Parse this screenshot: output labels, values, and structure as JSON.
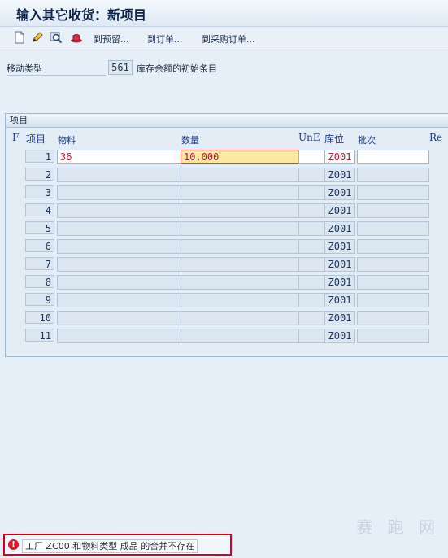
{
  "window": {
    "title": "输入其它收货：新项目"
  },
  "toolbar": {
    "icons": [
      "new-document-icon",
      "edit-pencil-icon",
      "magnifier-icon",
      "hat-icon"
    ],
    "buttons": [
      "到预留...",
      "到订单...",
      "到采购订单..."
    ]
  },
  "header": {
    "movement_type_label": "移动类型",
    "movement_type_value": "561",
    "movement_type_desc": "库存余额的初始条目"
  },
  "items_panel": {
    "title": "项目",
    "columns": {
      "f": "F",
      "item": "项目",
      "material": "物料",
      "quantity": "数量",
      "une": "UnE",
      "storage": "库位",
      "batch": "批次",
      "re": "Re"
    },
    "rows": [
      {
        "item": "1",
        "material": "36",
        "quantity": "10,000",
        "une": "",
        "storage": "Z001",
        "batch": ""
      },
      {
        "item": "2",
        "material": "",
        "quantity": "",
        "une": "",
        "storage": "Z001",
        "batch": ""
      },
      {
        "item": "3",
        "material": "",
        "quantity": "",
        "une": "",
        "storage": "Z001",
        "batch": ""
      },
      {
        "item": "4",
        "material": "",
        "quantity": "",
        "une": "",
        "storage": "Z001",
        "batch": ""
      },
      {
        "item": "5",
        "material": "",
        "quantity": "",
        "une": "",
        "storage": "Z001",
        "batch": ""
      },
      {
        "item": "6",
        "material": "",
        "quantity": "",
        "une": "",
        "storage": "Z001",
        "batch": ""
      },
      {
        "item": "7",
        "material": "",
        "quantity": "",
        "une": "",
        "storage": "Z001",
        "batch": ""
      },
      {
        "item": "8",
        "material": "",
        "quantity": "",
        "une": "",
        "storage": "Z001",
        "batch": ""
      },
      {
        "item": "9",
        "material": "",
        "quantity": "",
        "une": "",
        "storage": "Z001",
        "batch": ""
      },
      {
        "item": "10",
        "material": "",
        "quantity": "",
        "une": "",
        "storage": "Z001",
        "batch": ""
      },
      {
        "item": "11",
        "material": "",
        "quantity": "",
        "une": "",
        "storage": "Z001",
        "batch": ""
      }
    ]
  },
  "status_bar": {
    "type": "error",
    "icon": "error-icon",
    "message": "工厂 ZC00 和物料类型 成品 的合并不存在"
  },
  "watermark": "赛 跑 网",
  "colors": {
    "error": "#d6001c",
    "highlight": "#fde9a1",
    "label_blue": "#1c3a8a"
  }
}
